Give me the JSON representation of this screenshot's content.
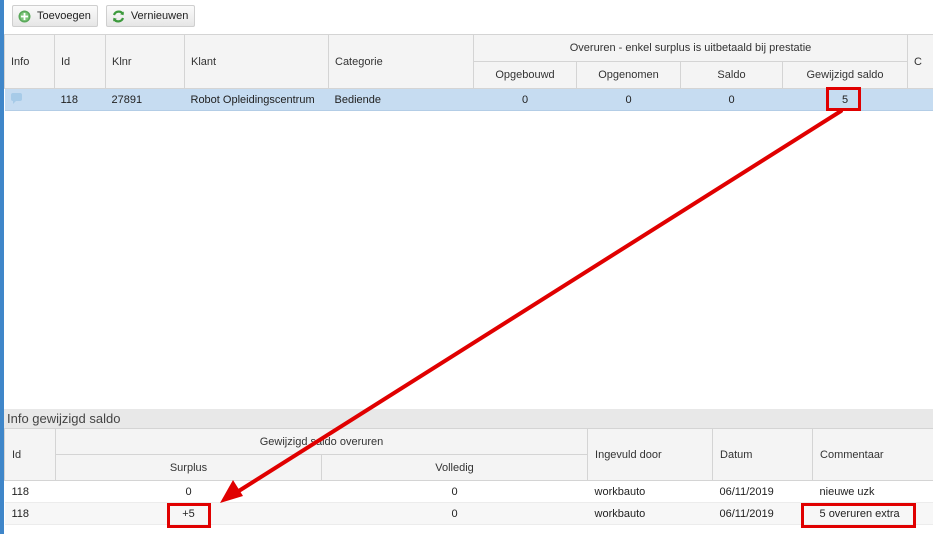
{
  "toolbar": {
    "add_label": "Toevoegen",
    "refresh_label": "Vernieuwen"
  },
  "main_grid": {
    "headers": {
      "info": "Info",
      "id": "Id",
      "klnr": "Klnr",
      "klant": "Klant",
      "categorie": "Categorie",
      "group": "Overuren - enkel surplus is uitbetaald bij prestatie",
      "opgebouwd": "Opgebouwd",
      "opgenomen": "Opgenomen",
      "saldo": "Saldo",
      "gewijzigd_saldo": "Gewijzigd saldo",
      "cut": "C"
    },
    "rows": [
      {
        "id": "118",
        "klnr": "27891",
        "klant": "Robot Opleidingscentrum",
        "categorie": "Bediende",
        "opgebouwd": "0",
        "opgenomen": "0",
        "saldo": "0",
        "gewijzigd_saldo": "5"
      }
    ]
  },
  "info_section": {
    "title": "Info gewijzigd saldo"
  },
  "sub_grid": {
    "headers": {
      "id": "Id",
      "group": "Gewijzigd saldo overuren",
      "surplus": "Surplus",
      "volledig": "Volledig",
      "ingevuld_door": "Ingevuld door",
      "datum": "Datum",
      "commentaar": "Commentaar"
    },
    "rows": [
      {
        "id": "118",
        "surplus": "0",
        "volledig": "0",
        "ingevuld_door": "workbauto",
        "datum": "06/11/2019",
        "commentaar": "nieuwe uzk"
      },
      {
        "id": "118",
        "surplus": "+5",
        "volledig": "0",
        "ingevuld_door": "workbauto",
        "datum": "06/11/2019",
        "commentaar": "5 overuren extra"
      }
    ]
  },
  "colors": {
    "selection": "#c6dcf1",
    "annotation": "#e00000",
    "accent": "#3f86c9"
  }
}
